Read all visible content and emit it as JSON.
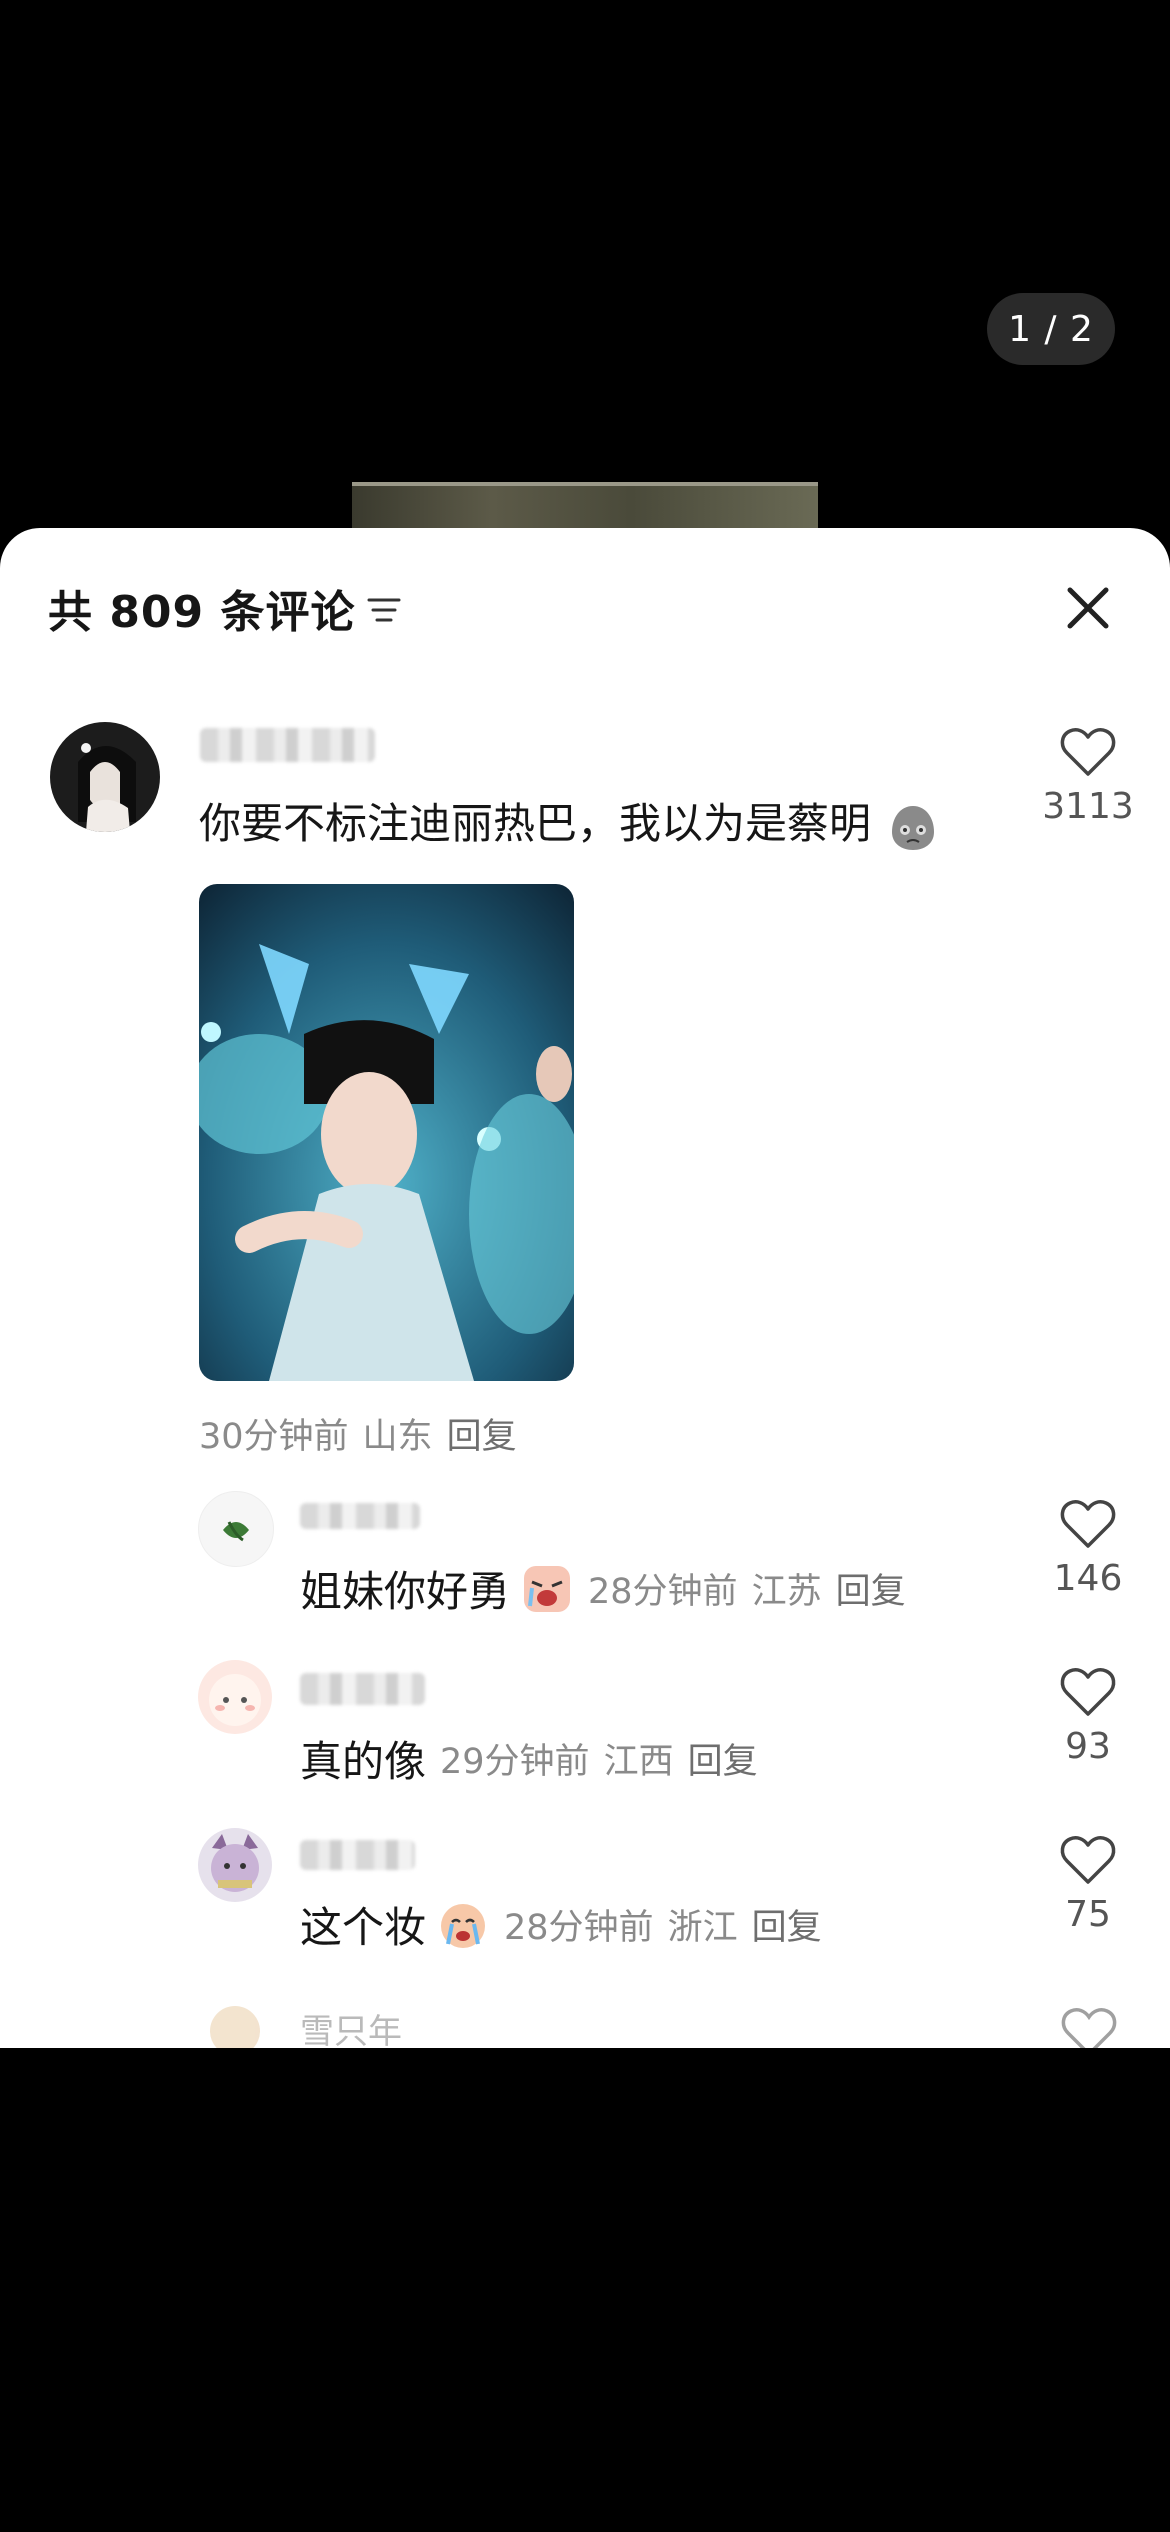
{
  "pager": {
    "text": "1 / 2"
  },
  "header": {
    "title": "共 809 条评论"
  },
  "main_comment": {
    "text": "你要不标注迪丽热巴，我以为是蔡明",
    "time": "30分钟前",
    "location": "山东",
    "reply": "回复",
    "likes": "3113"
  },
  "replies": [
    {
      "text": "姐妹你好勇",
      "time": "28分钟前",
      "location": "江苏",
      "reply": "回复",
      "likes": "146",
      "emoji": "crying-face-emoji"
    },
    {
      "text": "真的像",
      "time": "29分钟前",
      "location": "江西",
      "reply": "回复",
      "likes": "93"
    },
    {
      "text": "这个妆",
      "time": "28分钟前",
      "location": "浙江",
      "reply": "回复",
      "likes": "75",
      "emoji": "sobbing-face-emoji"
    }
  ],
  "partial_row": {
    "text": "雪只年"
  }
}
